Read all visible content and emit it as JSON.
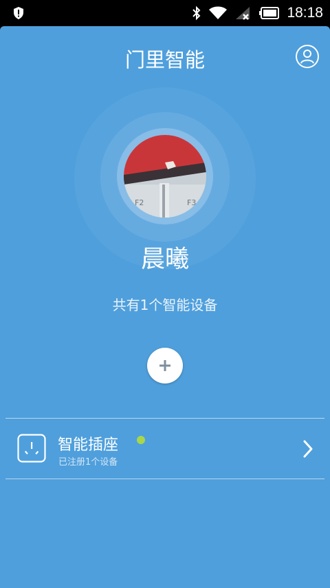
{
  "status_bar": {
    "time": "18:18",
    "icons": [
      "shield-alert-icon",
      "bluetooth-icon",
      "wifi-icon",
      "signal-off-icon",
      "battery-icon"
    ]
  },
  "header": {
    "title": "门里智能",
    "user_icon": "user-circle-icon"
  },
  "profile": {
    "name": "晨曦",
    "device_summary": "共有1个智能设备"
  },
  "add_button": {
    "icon": "plus-icon",
    "label": "+"
  },
  "devices": [
    {
      "name": "智能插座",
      "subtitle": "已注册1个设备",
      "icon": "power-socket-icon",
      "status": "online",
      "status_color": "#a9d64a"
    }
  ],
  "colors": {
    "background": "#4f9fdc",
    "status_bar": "#000000",
    "text": "#ffffff",
    "online": "#a9d64a"
  }
}
